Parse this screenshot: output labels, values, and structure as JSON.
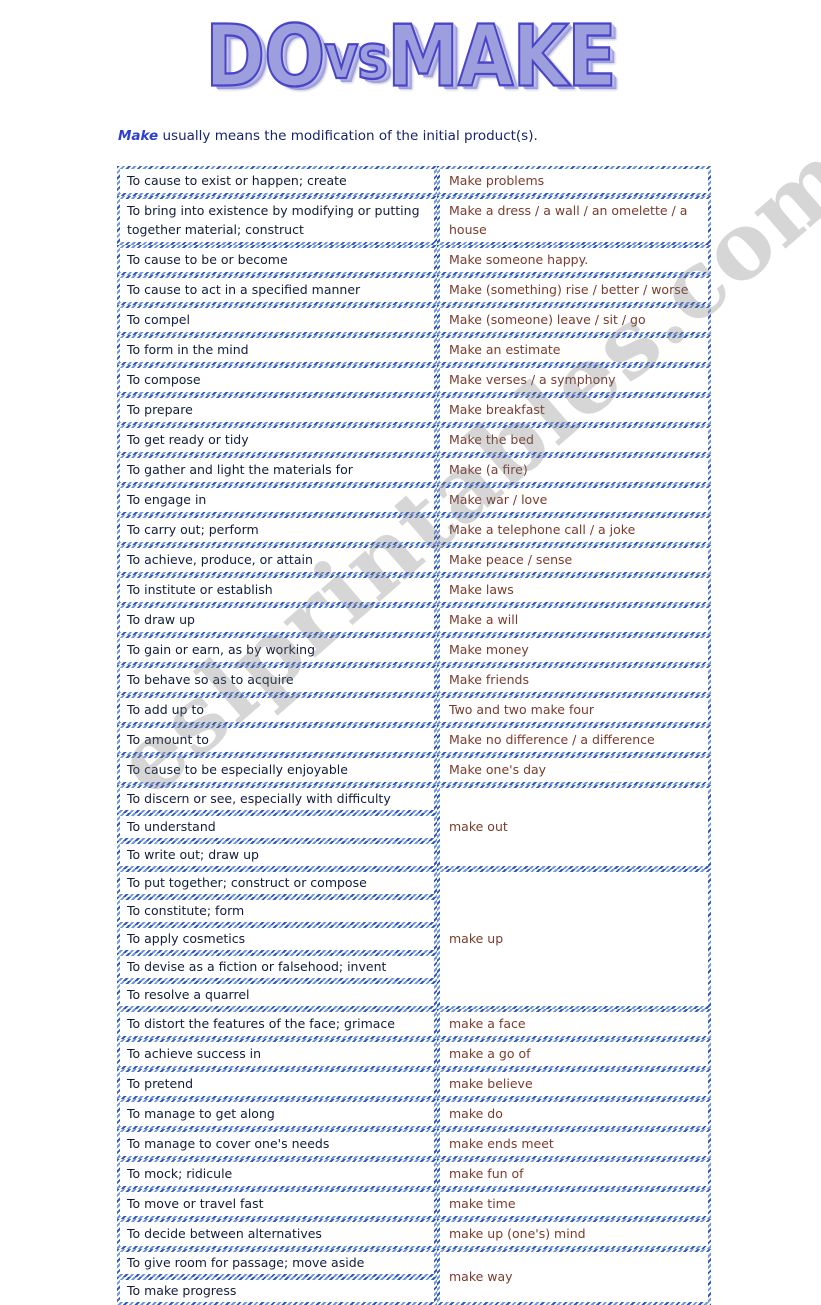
{
  "title": {
    "part1": "DO",
    "vs": "vs",
    "part2": "MAKE",
    "full": "DO vs MAKE",
    "fill_color": "#9d9edd",
    "outline_color": "#4a45c8"
  },
  "intro": {
    "keyword": "Make",
    "rest": " usually means the modification of the initial product(s)."
  },
  "watermark": {
    "text": "eslprintables.com"
  },
  "colors": {
    "definition_text": "#101c3a",
    "usage_text": "#7a3b2e",
    "border_dark": "#2f58c0",
    "border_light": "#6f95de",
    "intro_keyword": "#2b3fd0"
  },
  "table": {
    "columns": [
      "definition",
      "usage"
    ],
    "rows": [
      {
        "definition": "To cause to exist or happen; create",
        "usage": "Make problems",
        "usage_rowspan": 1
      },
      {
        "definition": "To bring into existence by modifying or putting together material; construct",
        "usage": "Make a dress / a wall / an omelette / a house",
        "usage_rowspan": 1,
        "lines": 2
      },
      {
        "definition": "To cause to be or become",
        "usage": "Make someone happy.",
        "usage_rowspan": 1
      },
      {
        "definition": "To cause to act in a specified manner",
        "usage": "Make (something) rise / better / worse",
        "usage_rowspan": 1
      },
      {
        "definition": "To compel",
        "usage": "Make (someone) leave / sit / go",
        "usage_rowspan": 1
      },
      {
        "definition": "To form in the mind",
        "usage": "Make an estimate",
        "usage_rowspan": 1
      },
      {
        "definition": "To compose",
        "usage": "Make verses / a symphony",
        "usage_rowspan": 1
      },
      {
        "definition": "To prepare",
        "usage": "Make breakfast",
        "usage_rowspan": 1
      },
      {
        "definition": "To get ready or tidy",
        "usage": "Make the bed",
        "usage_rowspan": 1
      },
      {
        "definition": "To gather and light the materials for",
        "usage": "Make (a fire)",
        "usage_rowspan": 1
      },
      {
        "definition": "To engage in",
        "usage": "Make war / love",
        "usage_rowspan": 1
      },
      {
        "definition": "To carry out; perform",
        "usage": "Make a telephone call / a joke",
        "usage_rowspan": 1
      },
      {
        "definition": "To achieve, produce, or attain",
        "usage": "Make peace / sense",
        "usage_rowspan": 1
      },
      {
        "definition": "To institute or establish",
        "usage": "Make laws",
        "usage_rowspan": 1
      },
      {
        "definition": "To draw up",
        "usage": "Make a will",
        "usage_rowspan": 1
      },
      {
        "definition": "To gain or earn, as by working",
        "usage": "Make money",
        "usage_rowspan": 1
      },
      {
        "definition": "To behave so as to acquire",
        "usage": "Make friends",
        "usage_rowspan": 1
      },
      {
        "definition": "To add up to",
        "usage": "Two and two make four",
        "usage_rowspan": 1
      },
      {
        "definition": "To amount to",
        "usage": "Make no difference / a difference",
        "usage_rowspan": 1
      },
      {
        "definition": "To cause to be especially enjoyable",
        "usage": "Make one's day",
        "usage_rowspan": 1
      },
      {
        "definition": "To discern or see, especially with difficulty",
        "usage": "make out",
        "usage_rowspan": 3
      },
      {
        "definition": "To understand",
        "usage": null,
        "usage_rowspan": 0
      },
      {
        "definition": "To write out; draw up",
        "usage": null,
        "usage_rowspan": 0
      },
      {
        "definition": "To put together; construct or compose",
        "usage": "make up",
        "usage_rowspan": 5
      },
      {
        "definition": "To constitute; form",
        "usage": null,
        "usage_rowspan": 0
      },
      {
        "definition": "To apply cosmetics",
        "usage": null,
        "usage_rowspan": 0
      },
      {
        "definition": "To devise as a fiction or falsehood; invent",
        "usage": null,
        "usage_rowspan": 0
      },
      {
        "definition": "To resolve a quarrel",
        "usage": null,
        "usage_rowspan": 0
      },
      {
        "definition": "To distort the features of the face; grimace",
        "usage": "make a face",
        "usage_rowspan": 1
      },
      {
        "definition": "To achieve success in",
        "usage": "make a go of",
        "usage_rowspan": 1
      },
      {
        "definition": "To pretend",
        "usage": "make believe",
        "usage_rowspan": 1
      },
      {
        "definition": "To manage to get along",
        "usage": "make do",
        "usage_rowspan": 1
      },
      {
        "definition": "To manage to cover one's needs",
        "usage": "make ends meet",
        "usage_rowspan": 1
      },
      {
        "definition": "To mock; ridicule",
        "usage": "make fun of",
        "usage_rowspan": 1
      },
      {
        "definition": "To move or travel fast",
        "usage": "make time",
        "usage_rowspan": 1
      },
      {
        "definition": "To decide between alternatives",
        "usage": "make up (one's) mind",
        "usage_rowspan": 1
      },
      {
        "definition": "To give room for passage; move aside",
        "usage": "make way",
        "usage_rowspan": 2
      },
      {
        "definition": "To make progress",
        "usage": null,
        "usage_rowspan": 0
      }
    ]
  }
}
